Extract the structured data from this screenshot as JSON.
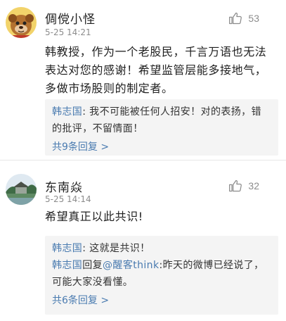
{
  "comments": [
    {
      "user": "倜傥小怪",
      "time": "5-25 14:21",
      "likes": "53",
      "text": "韩教授，作为一个老股民，千言万语也无法表达对您的感谢！希望监管层能多接地气，多做市场股则的制定者。",
      "replies": [
        {
          "name": "韩志国",
          "sep": ": ",
          "text": "我不可能被任何人招安！对的表扬，错的批评，不留情面！"
        }
      ],
      "more": "共9条回复 >"
    },
    {
      "user": "东南焱",
      "time": "5-25 14:14",
      "likes": "32",
      "text": "希望真正以此共识!",
      "replies": [
        {
          "name": "韩志国",
          "sep": ": ",
          "text": "这就是共识！"
        },
        {
          "name": "韩志国",
          "pre": "回复",
          "mention": "@醒客think",
          "sep": ":",
          "text": "昨天的微博已经说了，可能大家没看懂。"
        }
      ],
      "more": "共6条回复 >"
    }
  ],
  "icons": {
    "like": "thumbs-up-icon"
  },
  "colors": {
    "link": "#4a7bb0",
    "reply_bg": "#f4f4f4",
    "meta": "#8c8c8c"
  }
}
